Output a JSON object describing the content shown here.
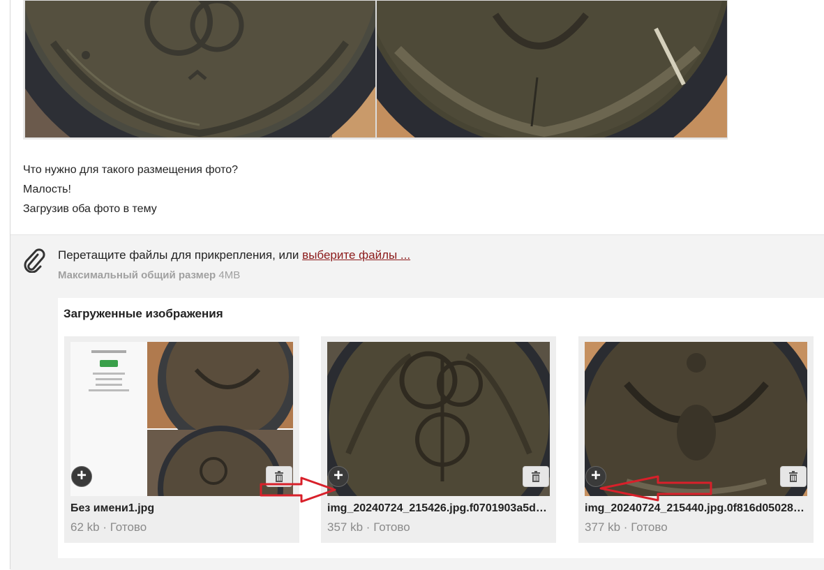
{
  "post": {
    "lines": [
      "Что нужно для такого размещения фото?",
      "Малость!",
      "Загрузив оба фото в тему"
    ]
  },
  "attach": {
    "drop_text": "Перетащите файлы для прикрепления, или ",
    "choose_link": "выберите файлы ...",
    "max_size_label": "Максимальный общий размер",
    "max_size_value": "4MB"
  },
  "uploaded": {
    "title": "Загруженные изображения",
    "files": [
      {
        "name": "Без имени1.jpg",
        "size": "62 kb",
        "sep": "·",
        "status": "Готово"
      },
      {
        "name": "img_20240724_215426.jpg.f0701903a5d…",
        "size": "357 kb",
        "sep": "·",
        "status": "Готово"
      },
      {
        "name": "img_20240724_215440.jpg.0f816d05028…",
        "size": "377 kb",
        "sep": "·",
        "status": "Готово"
      }
    ]
  },
  "icons": {
    "attach": "paperclip-icon",
    "add": "plus-circle-icon",
    "delete": "trash-icon"
  },
  "colors": {
    "link": "#8b1a1a",
    "arrow": "#d8202a",
    "coin": "#5a4a3c"
  }
}
